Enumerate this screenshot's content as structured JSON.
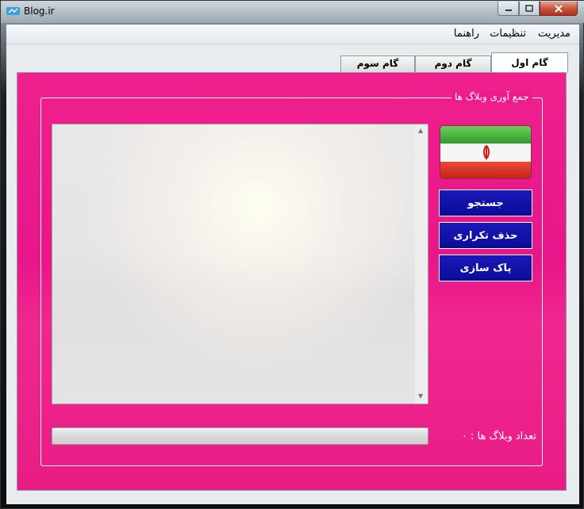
{
  "window": {
    "title": "Blog.ir"
  },
  "menu": {
    "items": [
      "مدیریت",
      "تنظیمات",
      "راهنما"
    ]
  },
  "tabs": [
    {
      "label": "گام اول",
      "active": true
    },
    {
      "label": "گام دوم",
      "active": false
    },
    {
      "label": "گام سوم",
      "active": false
    }
  ],
  "group": {
    "title": "جمع آوری وبلاگ ها"
  },
  "buttons": {
    "search": "جستجو",
    "remove_duplicates": "حذف تکراری",
    "clear": "پاک سازی"
  },
  "progress": {
    "value": 0
  },
  "count": {
    "label": "تعداد وبلاگ ها :",
    "value": "۰"
  },
  "colors": {
    "panel": "#ec1d8b",
    "button": "#0b0b9a",
    "flag_green": "#2e9b2a",
    "flag_red": "#c41f14"
  },
  "icons": {
    "app": "blog-logo-icon",
    "flag": "iran-flag-icon"
  }
}
